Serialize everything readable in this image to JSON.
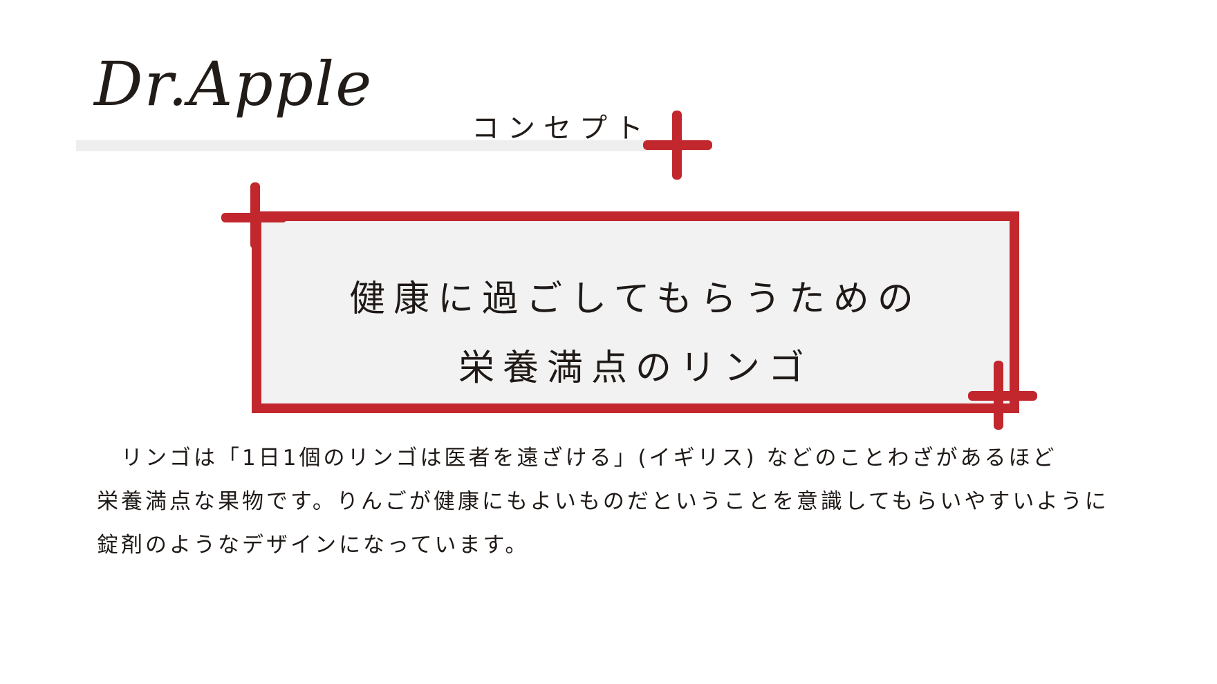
{
  "header": {
    "logo_text": "Dr.Apple",
    "subtitle": "コンセプト"
  },
  "panel": {
    "line1": "健康に過ごしてもらうための",
    "line2": "栄養満点のリンゴ"
  },
  "body": {
    "line1": "　リンゴは「1日1個のリンゴは医者を遠ざける」(イギリス) などのことわざがあるほど",
    "line2": "栄養満点な果物です。りんごが健康にもよいものだということを意識してもらいやすいように",
    "line3": "錠剤のようなデザインになっています。"
  },
  "colors": {
    "accent": "#c1272d",
    "panel_background": "#f2f2f2",
    "divider": "#eeeeee",
    "text": "#1f1a17"
  }
}
